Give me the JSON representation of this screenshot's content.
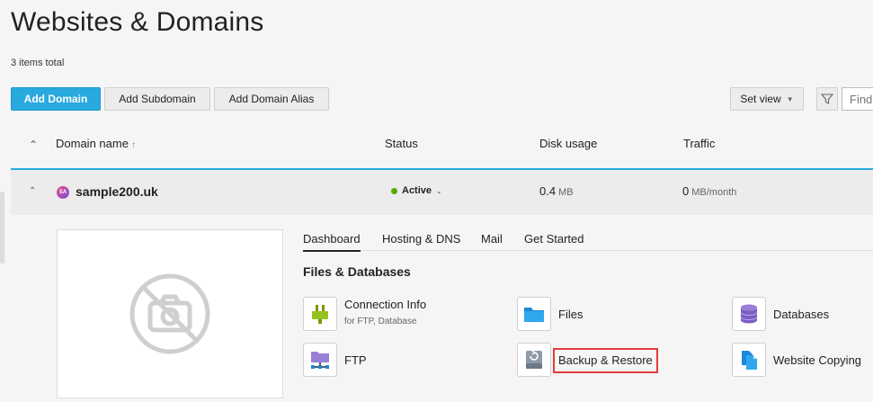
{
  "page": {
    "title": "Websites & Domains",
    "items_total": "3 items total"
  },
  "toolbar": {
    "add_domain": "Add Domain",
    "add_subdomain": "Add Subdomain",
    "add_domain_alias": "Add Domain Alias",
    "set_view": "Set view",
    "find_placeholder": "Find"
  },
  "table": {
    "columns": {
      "domain_name": "Domain name",
      "status": "Status",
      "disk_usage": "Disk usage",
      "traffic": "Traffic"
    },
    "rows": [
      {
        "avatar": "SA",
        "domain": "sample200.uk",
        "status": "Active",
        "disk_value": "0.4",
        "disk_unit": "MB",
        "traffic_value": "0",
        "traffic_unit": "MB/month"
      }
    ]
  },
  "details": {
    "tabs": [
      "Dashboard",
      "Hosting & DNS",
      "Mail",
      "Get Started"
    ],
    "section_title": "Files & Databases",
    "tiles": {
      "connection_info": {
        "label": "Connection Info",
        "sub": "for FTP, Database"
      },
      "files": {
        "label": "Files"
      },
      "databases": {
        "label": "Databases"
      },
      "ftp": {
        "label": "FTP"
      },
      "backup_restore": {
        "label": "Backup & Restore"
      },
      "website_copying": {
        "label": "Website Copying"
      }
    }
  },
  "colors": {
    "accent": "#28aade",
    "status_active": "#5aa800",
    "highlight": "#e43b3b"
  }
}
